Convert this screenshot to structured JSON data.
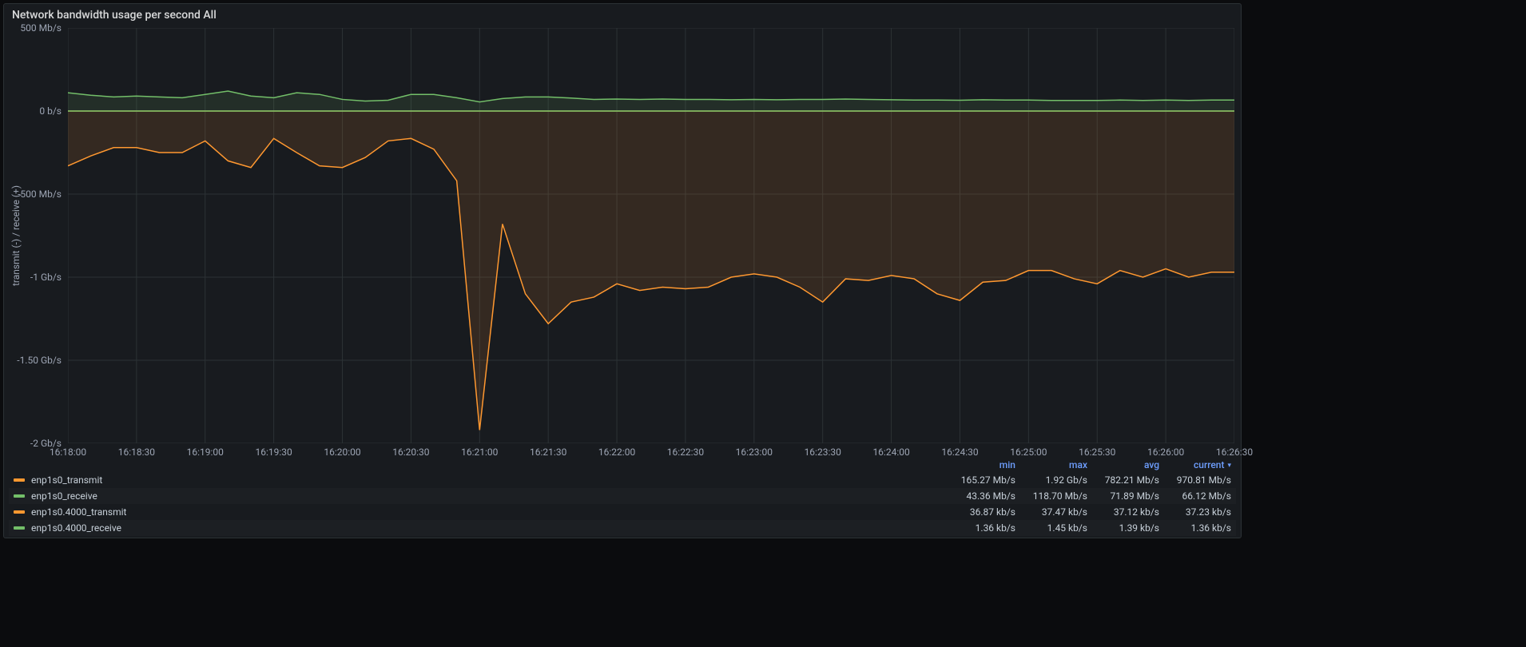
{
  "panel": {
    "title": "Network bandwidth usage per second All",
    "y_axis_label": "transmit (-) / receive (+)"
  },
  "legend_header": {
    "min": "min",
    "max": "max",
    "avg": "avg",
    "current": "current"
  },
  "series_meta": [
    {
      "name": "enp1s0_transmit",
      "color": "#ff9830",
      "min": "165.27 Mb/s",
      "max": "1.92 Gb/s",
      "avg": "782.21 Mb/s",
      "current": "970.81 Mb/s"
    },
    {
      "name": "enp1s0_receive",
      "color": "#73bf69",
      "min": "43.36 Mb/s",
      "max": "118.70 Mb/s",
      "avg": "71.89 Mb/s",
      "current": "66.12 Mb/s"
    },
    {
      "name": "enp1s0.4000_transmit",
      "color": "#ff9830",
      "min": "36.87 kb/s",
      "max": "37.47 kb/s",
      "avg": "37.12 kb/s",
      "current": "37.23 kb/s"
    },
    {
      "name": "enp1s0.4000_receive",
      "color": "#73bf69",
      "min": "1.36 kb/s",
      "max": "1.45 kb/s",
      "avg": "1.39 kb/s",
      "current": "1.36 kb/s"
    }
  ],
  "chart_data": {
    "type": "line",
    "title": "Network bandwidth usage per second All",
    "xlabel": "",
    "ylabel": "transmit (-) / receive (+)",
    "ylim": [
      -2000,
      500
    ],
    "y_unit": "Mb/s",
    "y_ticks": [
      {
        "v": 500,
        "label": "500 Mb/s"
      },
      {
        "v": 0,
        "label": "0 b/s"
      },
      {
        "v": -500,
        "label": "-500 Mb/s"
      },
      {
        "v": -1000,
        "label": "-1 Gb/s"
      },
      {
        "v": -1500,
        "label": "-1.50 Gb/s"
      },
      {
        "v": -2000,
        "label": "-2 Gb/s"
      }
    ],
    "x": [
      "16:18:00",
      "16:18:10",
      "16:18:20",
      "16:18:30",
      "16:18:40",
      "16:18:50",
      "16:19:00",
      "16:19:10",
      "16:19:20",
      "16:19:30",
      "16:19:40",
      "16:19:50",
      "16:20:00",
      "16:20:10",
      "16:20:20",
      "16:20:30",
      "16:20:40",
      "16:20:50",
      "16:21:00",
      "16:21:10",
      "16:21:20",
      "16:21:30",
      "16:21:40",
      "16:21:50",
      "16:22:00",
      "16:22:10",
      "16:22:20",
      "16:22:30",
      "16:22:40",
      "16:22:50",
      "16:23:00",
      "16:23:10",
      "16:23:20",
      "16:23:30",
      "16:23:40",
      "16:23:50",
      "16:24:00",
      "16:24:10",
      "16:24:20",
      "16:24:30",
      "16:24:40",
      "16:24:50",
      "16:25:00",
      "16:25:10",
      "16:25:20",
      "16:25:30",
      "16:25:40",
      "16:25:50",
      "16:26:00",
      "16:26:10",
      "16:26:20",
      "16:26:30"
    ],
    "x_tick_labels": [
      "16:18:00",
      "16:18:30",
      "16:19:00",
      "16:19:30",
      "16:20:00",
      "16:20:30",
      "16:21:00",
      "16:21:30",
      "16:22:00",
      "16:22:30",
      "16:23:00",
      "16:23:30",
      "16:24:00",
      "16:24:30",
      "16:25:00",
      "16:25:30",
      "16:26:00",
      "16:26:30"
    ],
    "series": [
      {
        "name": "enp1s0_receive",
        "color": "#73bf69",
        "fill": true,
        "values": [
          110,
          95,
          85,
          90,
          85,
          80,
          100,
          120,
          90,
          80,
          110,
          100,
          70,
          60,
          65,
          100,
          100,
          80,
          55,
          75,
          85,
          85,
          78,
          70,
          72,
          70,
          72,
          70,
          70,
          68,
          70,
          68,
          70,
          70,
          72,
          70,
          68,
          66,
          66,
          65,
          68,
          66,
          66,
          64,
          64,
          64,
          66,
          64,
          66,
          64,
          66,
          66
        ]
      },
      {
        "name": "enp1s0_transmit",
        "color": "#ff9830",
        "fill": true,
        "values": [
          -330,
          -270,
          -220,
          -220,
          -250,
          -250,
          -180,
          -300,
          -340,
          -165,
          -250,
          -330,
          -340,
          -280,
          -180,
          -165,
          -230,
          -420,
          -1920,
          -680,
          -1100,
          -1280,
          -1150,
          -1120,
          -1040,
          -1080,
          -1060,
          -1070,
          -1060,
          -1000,
          -980,
          -1000,
          -1060,
          -1150,
          -1010,
          -1020,
          -990,
          -1010,
          -1100,
          -1140,
          -1030,
          -1020,
          -960,
          -960,
          -1010,
          -1040,
          -960,
          -1000,
          -950,
          -1000,
          -970,
          -970
        ]
      },
      {
        "name": "enp1s0.4000_transmit",
        "color": "#ff9830",
        "fill": false,
        "values": [
          -0.037,
          -0.037,
          -0.037,
          -0.037,
          -0.037,
          -0.037,
          -0.037,
          -0.037,
          -0.037,
          -0.037,
          -0.037,
          -0.037,
          -0.037,
          -0.037,
          -0.037,
          -0.037,
          -0.037,
          -0.037,
          -0.037,
          -0.037,
          -0.037,
          -0.037,
          -0.037,
          -0.037,
          -0.037,
          -0.037,
          -0.037,
          -0.037,
          -0.037,
          -0.037,
          -0.037,
          -0.037,
          -0.037,
          -0.037,
          -0.037,
          -0.037,
          -0.037,
          -0.037,
          -0.037,
          -0.037,
          -0.037,
          -0.037,
          -0.037,
          -0.037,
          -0.037,
          -0.037,
          -0.037,
          -0.037,
          -0.037,
          -0.037,
          -0.037,
          -0.037
        ]
      },
      {
        "name": "enp1s0.4000_receive",
        "color": "#73bf69",
        "fill": false,
        "values": [
          0.0014,
          0.0014,
          0.0014,
          0.0014,
          0.0014,
          0.0014,
          0.0014,
          0.0014,
          0.0014,
          0.0014,
          0.0014,
          0.0014,
          0.0014,
          0.0014,
          0.0014,
          0.0014,
          0.0014,
          0.0014,
          0.0014,
          0.0014,
          0.0014,
          0.0014,
          0.0014,
          0.0014,
          0.0014,
          0.0014,
          0.0014,
          0.0014,
          0.0014,
          0.0014,
          0.0014,
          0.0014,
          0.0014,
          0.0014,
          0.0014,
          0.0014,
          0.0014,
          0.0014,
          0.0014,
          0.0014,
          0.0014,
          0.0014,
          0.0014,
          0.0014,
          0.0014,
          0.0014,
          0.0014,
          0.0014,
          0.0014,
          0.0014,
          0.0014,
          0.0014
        ]
      }
    ]
  }
}
